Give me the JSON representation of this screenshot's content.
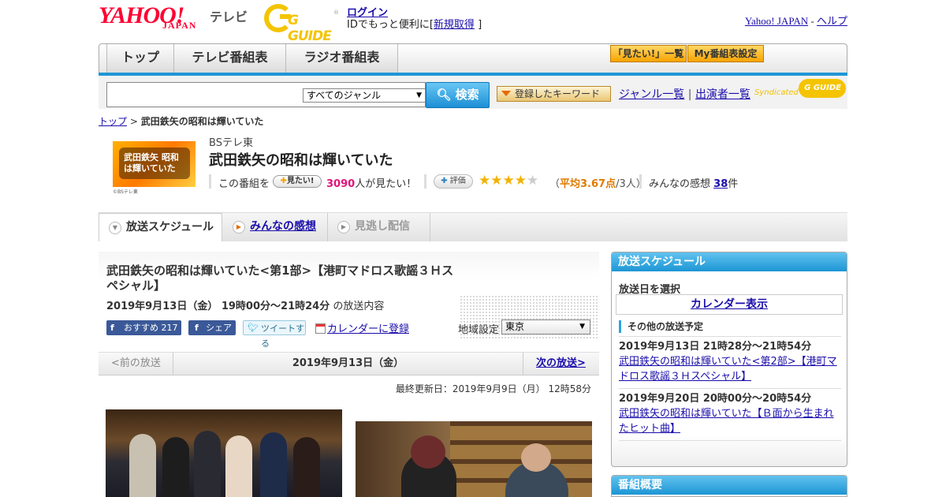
{
  "header": {
    "yahoo_logo": "YAHOO!",
    "yahoo_japan": "JAPAN",
    "tv_label": "テレビ",
    "gguide_logo": "G GUIDE",
    "gguide_reg": "®",
    "login": "ログイン",
    "id_text": "IDでもっと便利に[",
    "register": "新規取得",
    "id_close": "]",
    "yahoo_japan_link": "Yahoo! JAPAN",
    "link_sep": "-",
    "help": "ヘルプ"
  },
  "nav": {
    "tabs": [
      {
        "label": "トップ"
      },
      {
        "label": "テレビ番組表"
      },
      {
        "label": "ラジオ番組表"
      }
    ],
    "mitai_list": "「見たい!」一覧",
    "my_schedule": "My番組表設定"
  },
  "search": {
    "query": "",
    "genre_selected": "すべてのジャンル",
    "button": "検索",
    "keyword_button": "登録したキーワード",
    "genre_list": "ジャンル一覧",
    "link_divider": "|",
    "cast_list": "出演者一覧",
    "syndicated": "Syndicated",
    "syndicated_logo": "G GUIDE"
  },
  "breadcrumb": {
    "top": "トップ",
    "sep": ">",
    "current": "武田鉄矢の昭和は輝いていた"
  },
  "program": {
    "thumb_text": "武田鉄矢 昭和は輝いていた",
    "thumb_caption": "©BSテレ東",
    "channel": "BSテレ東",
    "title": "武田鉄矢の昭和は輝いていた",
    "kono": "この番組を",
    "mitai_button": "見たい!",
    "mitai_count": "3090",
    "mitai_suffix": "人が見たい！",
    "hyoka_button": "評価",
    "rating": 3.67,
    "avg_prefix": "（",
    "avg_value": "平均3.67点",
    "avg_suffix": "/3人）",
    "kanso_prefix": "みんなの感想",
    "kanso_count": "38",
    "kanso_suffix": "件"
  },
  "subtabs": {
    "schedule": "放送スケジュール",
    "kanso": "みんなの感想",
    "minogashi": "見逃し配信"
  },
  "episode": {
    "title": "武田鉄矢の昭和は輝いていた<第1部>【港町マドロス歌謡３Ｈスペシャル】",
    "datetime": "2019年9月13日（金） 19時00分～21時24分",
    "datetime_suffix": "の放送内容",
    "fb_recommend": "おすすめ",
    "fb_count": "217",
    "fb_share": "シェア",
    "tweet": "ツイートする",
    "calendar": "カレンダーに登録",
    "region_label": "地域設定",
    "region_value": "東京"
  },
  "pager": {
    "prev": "<前の放送",
    "date": "2019年9月13日（金）",
    "next": "次の放送>"
  },
  "updated": "最終更新日：2019年9月9日（月） 12時58分",
  "sidebar": {
    "schedule_title": "放送スケジュール",
    "select_day": "放送日を選択",
    "calendar_button": "カレンダー表示",
    "other_title": "その他の放送予定",
    "items": [
      {
        "datetime": "2019年9月13日 21時28分～21時54分",
        "title": "武田鉄矢の昭和は輝いていた<第2部>【港町マドロス歌謡３Ｈスペシャル】"
      },
      {
        "datetime": "2019年9月20日 20時00分～20時54分",
        "title": "武田鉄矢の昭和は輝いていた【Ｂ面から生まれたヒット曲】"
      }
    ],
    "overview_title": "番組概要"
  },
  "colors": {
    "accent_blue": "#2196d6",
    "yahoo_red": "#ff0033",
    "gguide_yellow": "#f4c400",
    "count_pink": "#e0157a"
  }
}
